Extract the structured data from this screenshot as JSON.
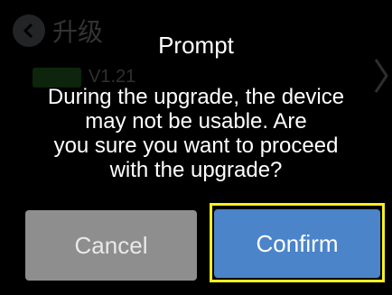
{
  "background_page": {
    "title": "升级",
    "version": "V1.21"
  },
  "dialog": {
    "title": "Prompt",
    "message_lines": [
      "During the upgrade, the device",
      "may not be usable. Are",
      "you sure you want to proceed",
      "with the upgrade?"
    ],
    "cancel_label": "Cancel",
    "confirm_label": "Confirm"
  },
  "colors": {
    "background": "#000000",
    "cancel_button": "#8e8e8e",
    "confirm_button": "#4b84c9",
    "focus_highlight": "#f7ef1f"
  },
  "icons": {
    "back": "back-arrow-icon",
    "forward": "chevron-right-icon"
  }
}
